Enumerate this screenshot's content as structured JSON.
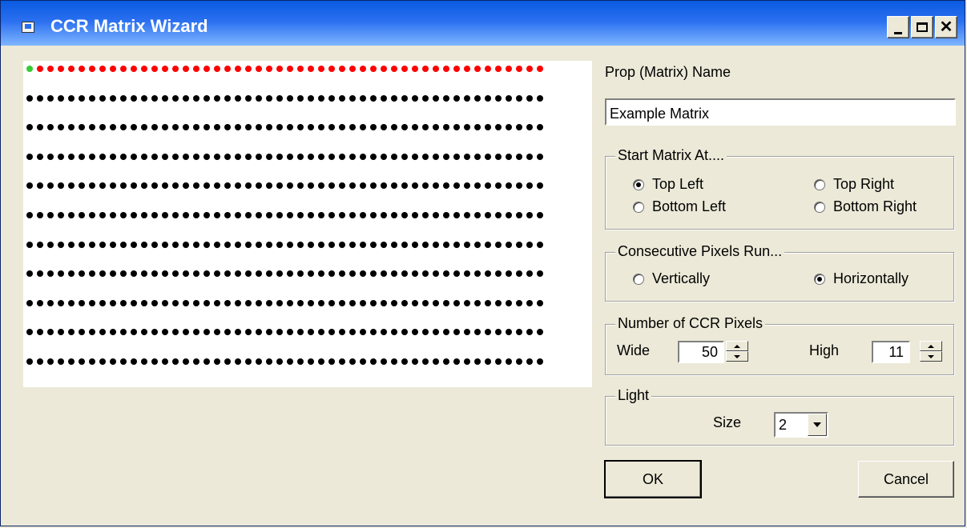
{
  "window": {
    "title": "CCR Matrix Wizard"
  },
  "matrix": {
    "columns": 50,
    "rows": 11,
    "colors": {
      "start": "#33cc33",
      "first_row": "#ff0000",
      "default": "#000000"
    }
  },
  "name_section": {
    "label": "Prop (Matrix) Name",
    "value": "Example Matrix"
  },
  "start_group": {
    "legend": "Start Matrix At....",
    "options": [
      {
        "label": "Top Left",
        "selected": true
      },
      {
        "label": "Top Right",
        "selected": false
      },
      {
        "label": "Bottom Left",
        "selected": false
      },
      {
        "label": "Bottom Right",
        "selected": false
      }
    ]
  },
  "run_group": {
    "legend": "Consecutive Pixels Run...",
    "options": [
      {
        "label": "Vertically",
        "selected": false
      },
      {
        "label": "Horizontally",
        "selected": true
      }
    ]
  },
  "pixels_group": {
    "legend": "Number of CCR Pixels",
    "wide_label": "Wide",
    "wide_value": "50",
    "high_label": "High",
    "high_value": "11"
  },
  "light_group": {
    "legend": "Light",
    "size_label": "Size",
    "size_value": "2"
  },
  "buttons": {
    "ok": "OK",
    "cancel": "Cancel"
  }
}
